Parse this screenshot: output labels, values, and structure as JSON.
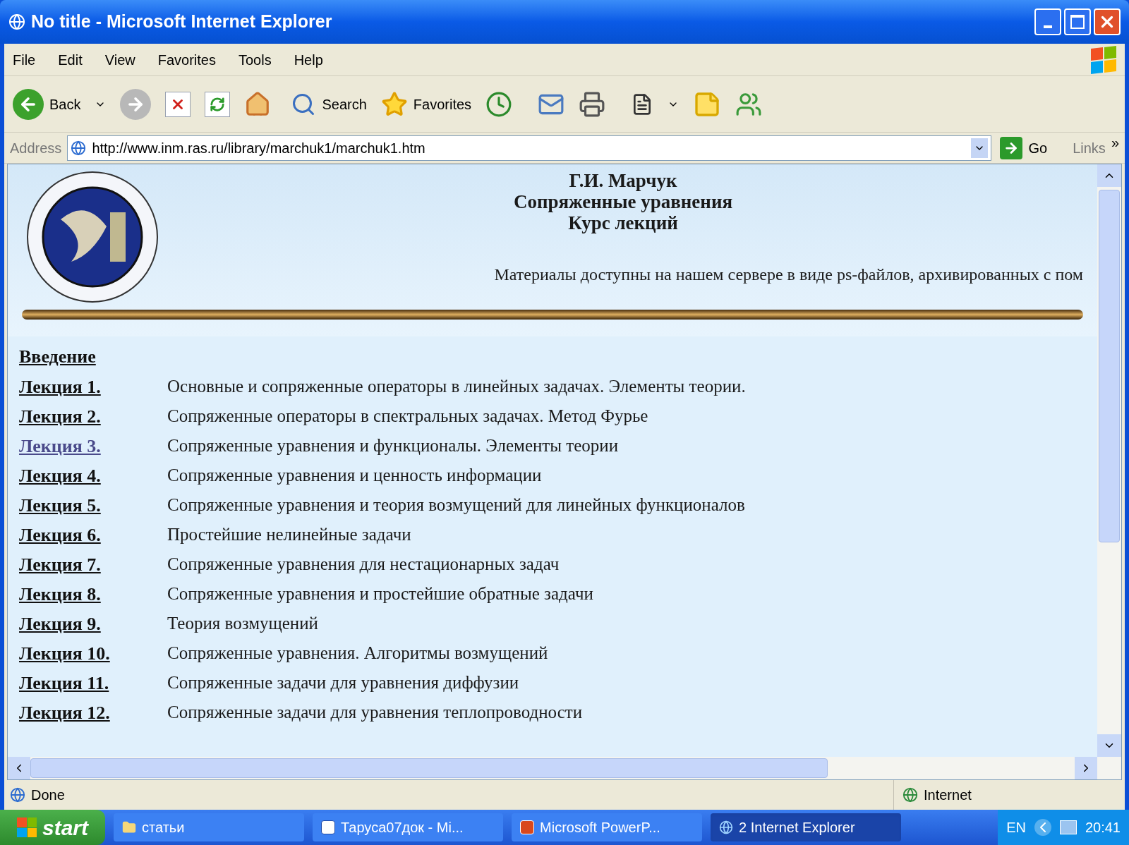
{
  "window": {
    "title": "No title - Microsoft Internet Explorer"
  },
  "menu": [
    "File",
    "Edit",
    "View",
    "Favorites",
    "Tools",
    "Help"
  ],
  "toolbar": {
    "back": "Back",
    "search": "Search",
    "favorites": "Favorites"
  },
  "address": {
    "label": "Address",
    "url": "http://www.inm.ras.ru/library/marchuk1/marchuk1.htm",
    "go": "Go",
    "links": "Links",
    "more": "»"
  },
  "page": {
    "header": [
      "Г.И. Марчук",
      "Сопряженные уравнения",
      "Курс лекций"
    ],
    "note": "Материалы доступны на нашем сервере в виде ps-файлов, архивированных с пом",
    "intro": {
      "label": "Введение",
      "visited": false
    },
    "lectures": [
      {
        "label": "Лекция 1.",
        "title": "Основные и сопряженные операторы в линейных задачах. Элементы теории.",
        "visited": false
      },
      {
        "label": "Лекция 2.",
        "title": "Сопряженные операторы в спектральных задачах. Метод Фурье",
        "visited": false
      },
      {
        "label": "Лекция 3.",
        "title": "Сопряженные уравнения и функционалы. Элементы теории",
        "visited": true
      },
      {
        "label": "Лекция 4.",
        "title": "Сопряженные уравнения и ценность информации",
        "visited": false
      },
      {
        "label": "Лекция 5.",
        "title": "Сопряженные уравнения и теория возмущений для линейных функционалов",
        "visited": false
      },
      {
        "label": "Лекция 6.",
        "title": "Простейшие нелинейные задачи",
        "visited": false
      },
      {
        "label": "Лекция 7.",
        "title": "Сопряженные уравнения для нестационарных задач",
        "visited": false
      },
      {
        "label": "Лекция 8.",
        "title": "Сопряженные уравнения и простейшие обратные задачи",
        "visited": false
      },
      {
        "label": "Лекция 9.",
        "title": "Теория возмущений",
        "visited": false
      },
      {
        "label": "Лекция 10.",
        "title": "Сопряженные уравнения. Алгоритмы возмущений",
        "visited": false
      },
      {
        "label": "Лекция 11.",
        "title": "Сопряженные задачи для уравнения диффузии",
        "visited": false
      },
      {
        "label": "Лекция 12.",
        "title": "Сопряженные задачи для уравнения теплопроводности",
        "visited": false
      }
    ]
  },
  "status_bar": {
    "text": "Done",
    "zone": "Internet"
  },
  "taskbar": {
    "start": "start",
    "tasks": [
      {
        "kind": "folder",
        "label": "статьи",
        "selected": false
      },
      {
        "kind": "word",
        "label": "Тарусa07док - Mi...",
        "selected": false
      },
      {
        "kind": "powerpoint",
        "label": "Microsoft PowerP...",
        "selected": false
      },
      {
        "kind": "ie",
        "label": "2 Internet Explorer",
        "selected": true
      }
    ],
    "language": "EN",
    "clock": "20:41"
  }
}
